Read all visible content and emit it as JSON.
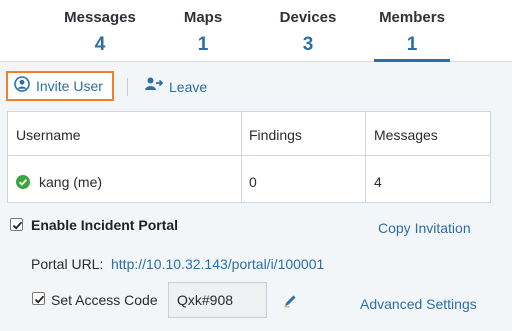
{
  "tabs": [
    {
      "label": "Messages",
      "count": "4"
    },
    {
      "label": "Maps",
      "count": "1"
    },
    {
      "label": "Devices",
      "count": "3"
    },
    {
      "label": "Members",
      "count": "1"
    }
  ],
  "active_tab": "Members",
  "toolbar": {
    "invite_label": "Invite User",
    "leave_label": "Leave"
  },
  "members_table": {
    "columns": [
      "Username",
      "Findings",
      "Messages"
    ],
    "rows": [
      {
        "username": "kang (me)",
        "findings": "0",
        "messages": "4",
        "status_icon": "check-circle-icon"
      }
    ]
  },
  "incident_portal": {
    "enable_label": "Enable Incident Portal",
    "enabled": true,
    "copy_invitation_label": "Copy Invitation",
    "portal_url_label": "Portal URL:",
    "portal_url": "http://10.10.32.143/portal/i/100001",
    "access_code_label": "Set Access Code",
    "access_code_enabled": true,
    "access_code_value": "Qxk#908",
    "advanced_settings_label": "Advanced Settings"
  },
  "colors": {
    "accent": "#2a6fa8",
    "highlight_border": "#f07f2b",
    "status_ok": "#3aa53f"
  }
}
